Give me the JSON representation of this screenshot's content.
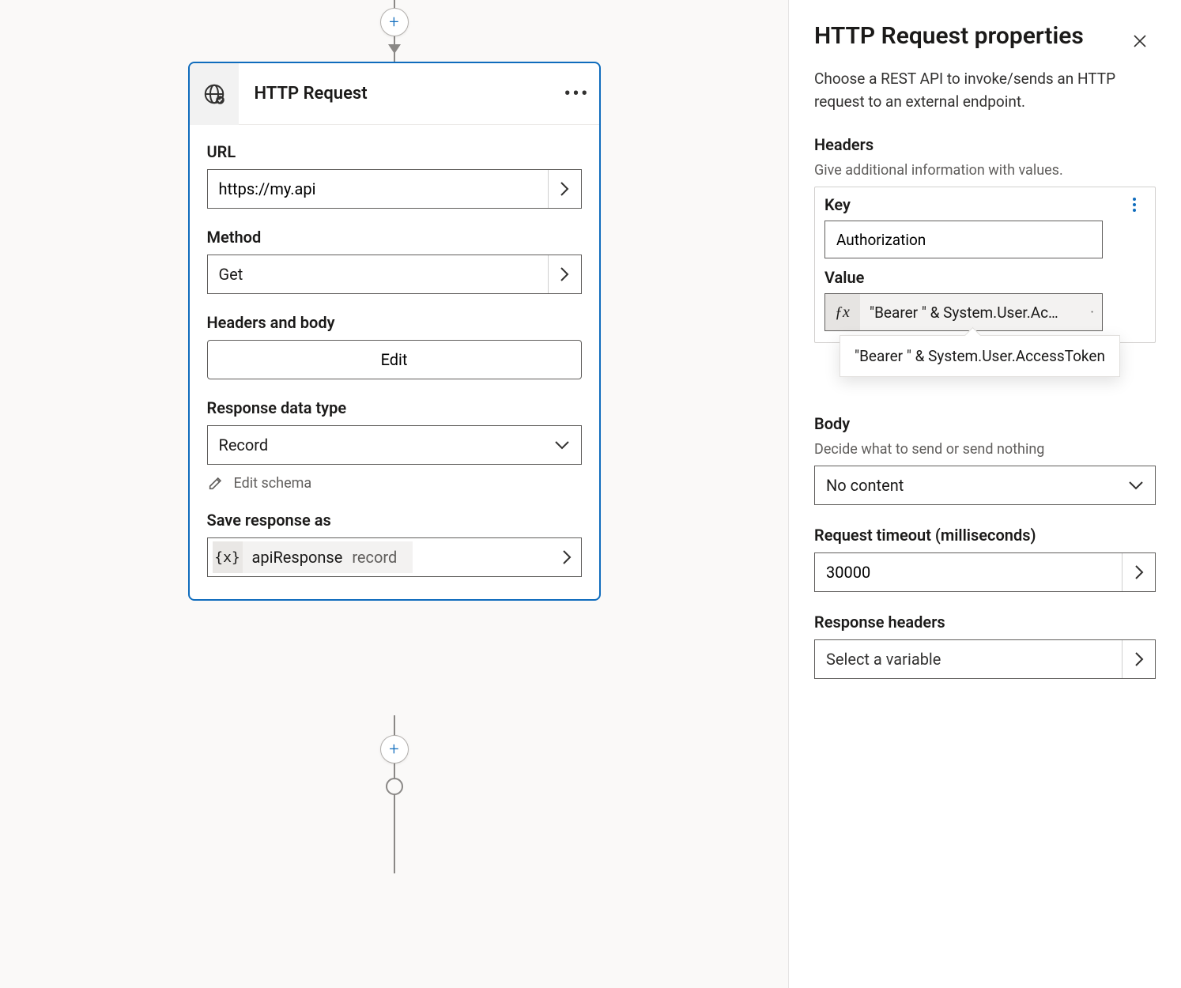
{
  "canvas": {
    "node": {
      "title": "HTTP Request",
      "url": {
        "label": "URL",
        "value": "https://my.api"
      },
      "method": {
        "label": "Method",
        "value": "Get"
      },
      "headers_body": {
        "label": "Headers and body",
        "edit_label": "Edit"
      },
      "response_type": {
        "label": "Response data type",
        "value": "Record"
      },
      "edit_schema_label": "Edit schema",
      "save_as": {
        "label": "Save response as",
        "variable_icon": "{x}",
        "variable_name": "apiResponse",
        "variable_type": "record"
      }
    }
  },
  "panel": {
    "title": "HTTP Request properties",
    "description": "Choose a REST API to invoke/sends an HTTP request to an external endpoint.",
    "headers": {
      "section_label": "Headers",
      "section_sub": "Give additional information with values.",
      "key_label": "Key",
      "key_value": "Authorization",
      "value_label": "Value",
      "fx_icon": "ƒx",
      "value_display": "\"Bearer \" & System.User.Ac…",
      "value_full": "\"Bearer \" & System.User.AccessToken"
    },
    "body": {
      "section_label": "Body",
      "section_sub": "Decide what to send or send nothing",
      "value": "No content"
    },
    "timeout": {
      "label": "Request timeout (milliseconds)",
      "value": "30000"
    },
    "response_headers": {
      "label": "Response headers",
      "placeholder": "Select a variable"
    }
  }
}
